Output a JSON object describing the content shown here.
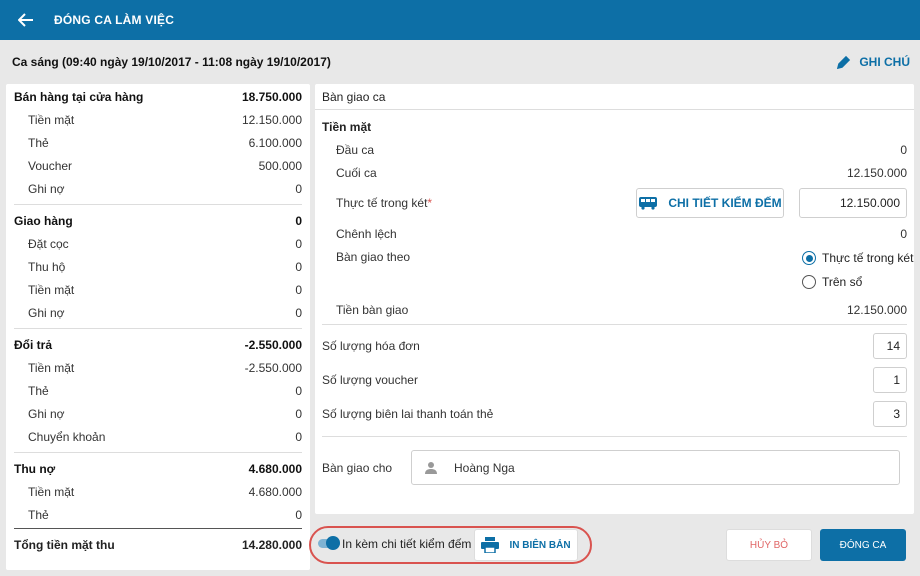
{
  "header": {
    "title": "ĐÓNG CA LÀM VIỆC"
  },
  "subheader": {
    "shift_label": "Ca sáng (09:40 ngày 19/10/2017 - 11:08 ngày 19/10/2017)",
    "note_label": "GHI CHÚ"
  },
  "summary": {
    "groups": [
      {
        "label": "Bán hàng tại cửa hàng",
        "value": "18.750.000",
        "items": [
          {
            "label": "Tiền mặt",
            "value": "12.150.000"
          },
          {
            "label": "Thẻ",
            "value": "6.100.000"
          },
          {
            "label": "Voucher",
            "value": "500.000"
          },
          {
            "label": "Ghi nợ",
            "value": "0"
          }
        ]
      },
      {
        "label": "Giao hàng",
        "value": "0",
        "items": [
          {
            "label": "Đặt cọc",
            "value": "0"
          },
          {
            "label": "Thu hộ",
            "value": "0"
          },
          {
            "label": "Tiền mặt",
            "value": "0"
          },
          {
            "label": "Ghi nợ",
            "value": "0"
          }
        ]
      },
      {
        "label": "Đổi trả",
        "value": "-2.550.000",
        "items": [
          {
            "label": "Tiền mặt",
            "value": "-2.550.000"
          },
          {
            "label": "Thẻ",
            "value": "0"
          },
          {
            "label": "Ghi nợ",
            "value": "0"
          },
          {
            "label": "Chuyển khoản",
            "value": "0"
          }
        ]
      },
      {
        "label": "Thu nợ",
        "value": "4.680.000",
        "items": [
          {
            "label": "Tiền mặt",
            "value": "4.680.000"
          },
          {
            "label": "Thẻ",
            "value": "0"
          }
        ]
      }
    ],
    "total": {
      "label": "Tổng tiền mặt thu",
      "value": "14.280.000"
    }
  },
  "handover": {
    "title": "Bàn giao ca",
    "cash_title": "Tiền mặt",
    "opening": {
      "label": "Đầu ca",
      "value": "0"
    },
    "closing": {
      "label": "Cuối ca",
      "value": "12.150.000"
    },
    "actual": {
      "label": "Thực tế trong két",
      "required_mark": "*",
      "value": "12.150.000"
    },
    "detail_button": "CHI TIẾT KIỂM ĐẾM",
    "difference": {
      "label": "Chênh lệch",
      "value": "0"
    },
    "handover_by": {
      "label": "Bàn giao theo",
      "options": [
        "Thực tế trong két",
        "Trên sổ"
      ],
      "selected": "Thực tế trong két"
    },
    "handover_amount": {
      "label": "Tiền bàn giao",
      "value": "12.150.000"
    },
    "invoice_count": {
      "label": "Số lượng hóa đơn",
      "value": "14"
    },
    "voucher_count": {
      "label": "Số lượng voucher",
      "value": "1"
    },
    "receipt_count": {
      "label": "Số lượng biên lai thanh toán thẻ",
      "value": "3"
    },
    "handover_to": {
      "label": "Bàn giao cho",
      "value": "Hoàng Nga"
    }
  },
  "footer": {
    "include_detail_label": "In kèm chi tiết kiểm đếm",
    "include_detail_on": true,
    "print_label": "IN BIÊN BẢN",
    "cancel_label": "HỦY BỎ",
    "close_label": "ĐÓNG CA"
  },
  "colors": {
    "primary": "#0d6fa6",
    "danger": "#d9534f"
  }
}
